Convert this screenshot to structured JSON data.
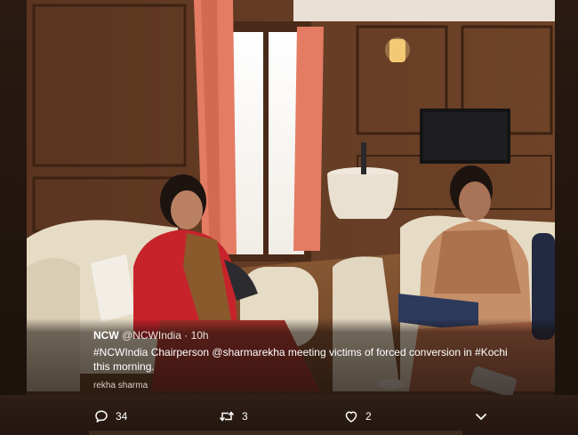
{
  "tweet": {
    "display_name": "NCW",
    "handle": "@NCWIndia",
    "separator": "·",
    "time": "10h",
    "text": "#NCWIndia Chairperson @sharmarekha meeting victims of forced conversion in #Kochi this morning.",
    "media_tag": "rekha sharma"
  },
  "actions": {
    "reply": {
      "icon": "reply-icon",
      "count": "34"
    },
    "retweet": {
      "icon": "retweet-icon",
      "count": "3"
    },
    "like": {
      "icon": "heart-icon",
      "count": "2"
    },
    "more": {
      "icon": "chevron-down-icon"
    }
  },
  "colors": {
    "overlay_text": "#ffffff",
    "secondary_text": "#e8e2dc",
    "background": "#2b1c14"
  }
}
